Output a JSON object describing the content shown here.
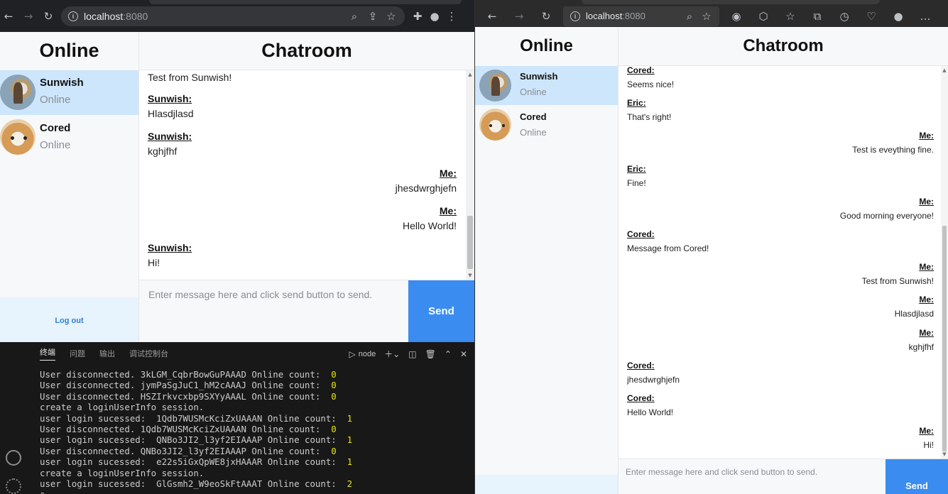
{
  "left_window": {
    "url_host": "localhost",
    "url_port": ":8080",
    "sidebar": {
      "title": "Online",
      "users": [
        {
          "name": "Sunwish",
          "status": "Online",
          "selected": true
        },
        {
          "name": "Cored",
          "status": "Online",
          "selected": false
        }
      ],
      "logout_label": "Log out"
    },
    "chat": {
      "title": "Chatroom",
      "messages": [
        {
          "sender": "",
          "text": "Test from Sunwish!",
          "mine": false
        },
        {
          "sender": "Sunwish:",
          "text": "Hlasdjlasd",
          "mine": false
        },
        {
          "sender": "Sunwish:",
          "text": "kghjfhf",
          "mine": false
        },
        {
          "sender": "Me:",
          "text": "jhesdwrghjefn",
          "mine": true
        },
        {
          "sender": "Me:",
          "text": "Hello World!",
          "mine": true
        },
        {
          "sender": "Sunwish:",
          "text": "Hi!",
          "mine": false
        }
      ],
      "input_placeholder": "Enter message here and click send button to send.",
      "send_label": "Send"
    }
  },
  "right_window": {
    "url_host": "localhost",
    "url_port": ":8080",
    "sidebar": {
      "title": "Online",
      "users": [
        {
          "name": "Sunwish",
          "status": "Online",
          "selected": true
        },
        {
          "name": "Cored",
          "status": "Online",
          "selected": false
        }
      ]
    },
    "chat": {
      "title": "Chatroom",
      "messages": [
        {
          "sender": "Cored:",
          "text": "Seems nice!",
          "mine": false
        },
        {
          "sender": "Eric:",
          "text": "That's right!",
          "mine": false
        },
        {
          "sender": "Me:",
          "text": "Test is eveything fine.",
          "mine": true
        },
        {
          "sender": "Eric:",
          "text": "Fine!",
          "mine": false
        },
        {
          "sender": "Me:",
          "text": "Good morning everyone!",
          "mine": true
        },
        {
          "sender": "Cored:",
          "text": "Message from Cored!",
          "mine": false
        },
        {
          "sender": "Me:",
          "text": "Test from Sunwish!",
          "mine": true
        },
        {
          "sender": "Me:",
          "text": "Hlasdjlasd",
          "mine": true
        },
        {
          "sender": "Me:",
          "text": "kghjfhf",
          "mine": true
        },
        {
          "sender": "Cored:",
          "text": "jhesdwrghjefn",
          "mine": false
        },
        {
          "sender": "Cored:",
          "text": "Hello World!",
          "mine": false
        },
        {
          "sender": "Me:",
          "text": "Hi!",
          "mine": true
        }
      ],
      "input_placeholder": "Enter message here and click send button to send.",
      "send_label": "Send"
    }
  },
  "terminal": {
    "tabs": [
      "终端",
      "问题",
      "输出",
      "调试控制台"
    ],
    "active_tab": "终端",
    "shell_label": "node",
    "lines": [
      {
        "text": "User disconnected. 3kLGM_CqbrBowGuPAAAD Online count:  ",
        "num": "0"
      },
      {
        "text": "User disconnected. jymPaSgJuC1_hM2cAAAJ Online count:  ",
        "num": "0"
      },
      {
        "text": "User disconnected. HSZIrkvcxbp9SXYyAAAL Online count:  ",
        "num": "0"
      },
      {
        "text": "create a loginUserInfo session.",
        "num": ""
      },
      {
        "text": "user login sucessed:  1Qdb7WUSMcKciZxUAAAN Online count:  ",
        "num": "1"
      },
      {
        "text": "User disconnected. 1Qdb7WUSMcKciZxUAAAN Online count:  ",
        "num": "0"
      },
      {
        "text": "user login sucessed:  QNBo3JI2_l3yf2EIAAAP Online count:  ",
        "num": "1"
      },
      {
        "text": "User disconnected. QNBo3JI2_l3yf2EIAAAP Online count:  ",
        "num": "0"
      },
      {
        "text": "user login sucessed:  e22s5iGxQpWE8jxHAAAR Online count:  ",
        "num": "1"
      },
      {
        "text": "create a loginUserInfo session.",
        "num": ""
      },
      {
        "text": "user login sucessed:  GlGsmh2_W9eoSkFtAAAT Online count:  ",
        "num": "2"
      }
    ]
  }
}
